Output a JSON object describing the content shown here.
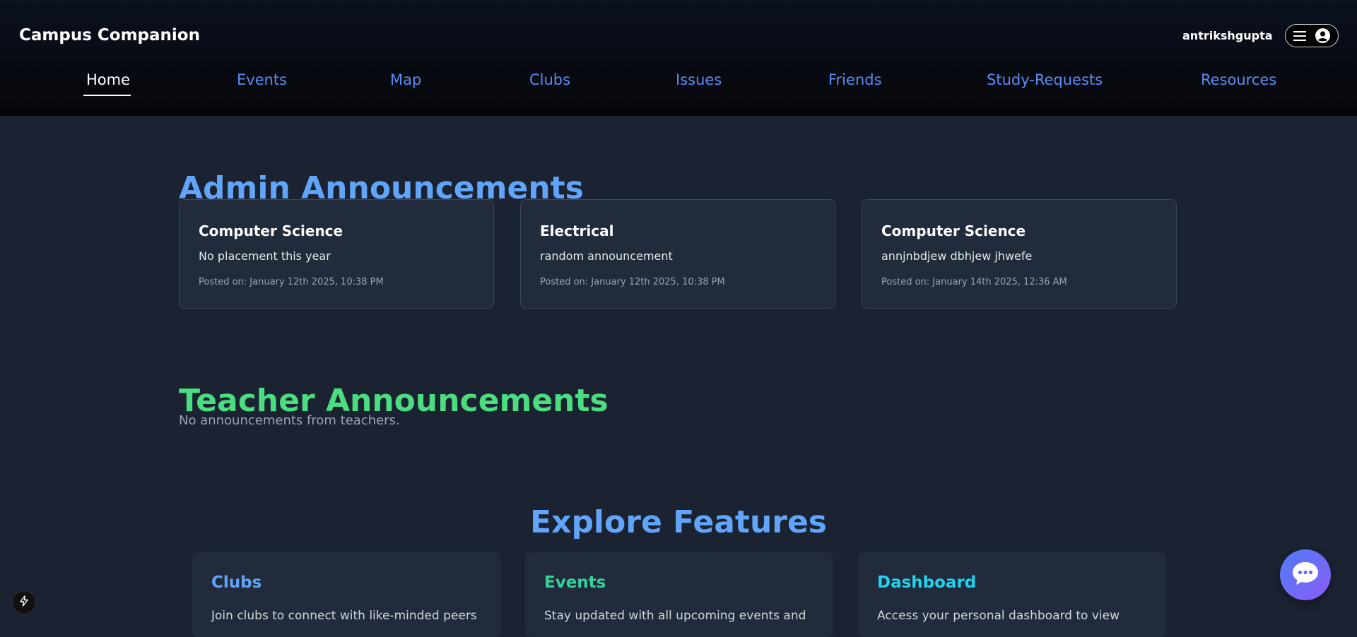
{
  "app": {
    "brand": "Campus Companion",
    "username": "antrikshgupta"
  },
  "nav": {
    "items": [
      {
        "label": "Home",
        "active": true
      },
      {
        "label": "Events",
        "active": false
      },
      {
        "label": "Map",
        "active": false
      },
      {
        "label": "Clubs",
        "active": false
      },
      {
        "label": "Issues",
        "active": false
      },
      {
        "label": "Friends",
        "active": false
      },
      {
        "label": "Study-Requests",
        "active": false
      },
      {
        "label": "Resources",
        "active": false
      }
    ]
  },
  "admin": {
    "title": "Admin Announcements",
    "cards": [
      {
        "title": "Computer Science",
        "body": "No placement this year",
        "date": "Posted on: January 12th 2025, 10:38 PM"
      },
      {
        "title": "Electrical",
        "body": "random announcement",
        "date": "Posted on: January 12th 2025, 10:38 PM"
      },
      {
        "title": "Computer Science",
        "body": "annjnbdjew dbhjew jhwefe",
        "date": "Posted on: January 14th 2025, 12:36 AM"
      }
    ]
  },
  "teacher": {
    "title": "Teacher Announcements",
    "empty": "No announcements from teachers."
  },
  "explore": {
    "title": "Explore Features",
    "cards": [
      {
        "title": "Clubs",
        "desc": "Join clubs to connect with like-minded peers",
        "color": "#60a5fa"
      },
      {
        "title": "Events",
        "desc": "Stay updated with all upcoming events and",
        "color": "#34d399"
      },
      {
        "title": "Dashboard",
        "desc": "Access your personal dashboard to view",
        "color": "#22d3ee"
      }
    ]
  },
  "icons": {
    "menu": "hamburger-icon",
    "user": "user-circle-icon",
    "chat": "chat-bubble-icon",
    "bolt": "lightning-bolt-icon"
  },
  "colors": {
    "accent": "#60a5fa",
    "nav_link": "#5b8cf5",
    "teacher_title": "#4ade80",
    "background": "#1b2232",
    "card": "#222b3b"
  }
}
